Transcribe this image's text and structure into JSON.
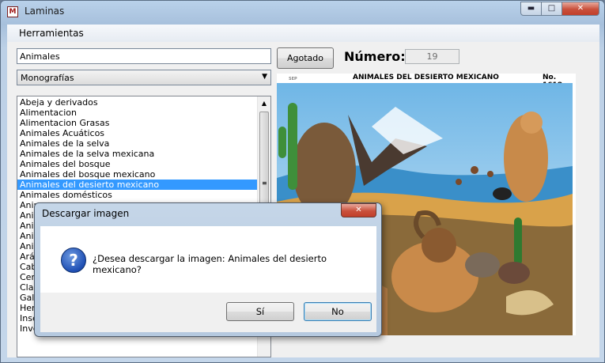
{
  "window": {
    "title": "Laminas",
    "icon_letter": "M",
    "controls": {
      "minimize": "▬",
      "maximize": "□",
      "close": "✕"
    }
  },
  "menu": {
    "items": [
      {
        "label": "Herramientas"
      }
    ]
  },
  "search": {
    "value": "Animales"
  },
  "category_select": {
    "selected": "Monografías",
    "arrow": "▼"
  },
  "list": {
    "items": [
      "Abeja y derivados",
      "Alimentacion",
      "Alimentacion Grasas",
      "Animales Acuáticos",
      "Animales de la selva",
      "Animales de la selva mexicana",
      "Animales del bosque",
      "Animales del bosque mexicano",
      "Animales del desierto mexicano",
      "Animales domésticos",
      "Anim",
      "Anim",
      "Anim",
      "Anim",
      "Anim",
      "Arác",
      "Cab",
      "Cere",
      "Clas",
      "Galli",
      "Herr",
      "Inse",
      "Inve"
    ],
    "selected_index": 8,
    "scroll_up": "▲",
    "scroll_grip": "≡"
  },
  "agotado_button": {
    "label": "Agotado"
  },
  "numero": {
    "label": "Número:",
    "value": "19"
  },
  "lamina": {
    "small_text": "SEP",
    "title": "ANIMALES DEL DESIERTO MEXICANO",
    "number": "No. 1618"
  },
  "dialog": {
    "title": "Descargar imagen",
    "close": "✕",
    "icon_glyph": "?",
    "message": "¿Desea descargar la imagen: Animales del desierto mexicano?",
    "yes_label": "Sí",
    "no_label": "No"
  },
  "colors": {
    "selection": "#3399ff",
    "titlebar": "#b9d1ea",
    "close_button": "#c9503c"
  }
}
